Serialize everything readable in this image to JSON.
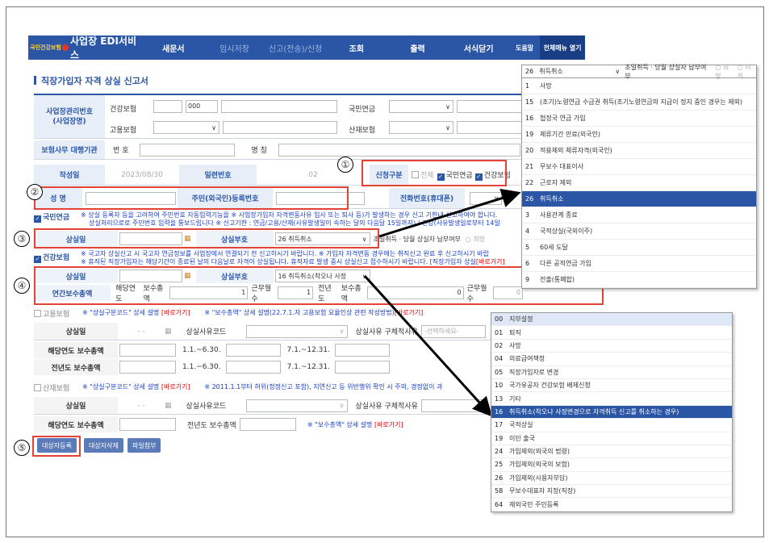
{
  "header": {
    "logo": "국민건강보험",
    "title": "사업장 EDI서비스",
    "menu": [
      "새문서",
      "임시저장",
      "신고(전송)/신청",
      "조회",
      "출력",
      "서식닫기"
    ],
    "help": "도움말",
    "all_menu": "전체메뉴 열기"
  },
  "page_title": "직장가입자 자격 상실 신고서",
  "biz": {
    "label": "사업장관리번호\n(사업장명)",
    "health": "건강보험",
    "health_val": "000",
    "pension": "국민연금",
    "employ": "고용보험",
    "injury": "산재보험",
    "agency": "보험사무 대행기관",
    "num": "번 호",
    "name": "명 칭"
  },
  "write_date_label": "작성일",
  "write_date": "2023/08/30",
  "serial_label": "일련번호",
  "serial": "02",
  "apply_label": "신청구분",
  "apply_all": "전체",
  "apply_pension": "국민연금",
  "apply_health": "건강보험",
  "name_label": "성   명",
  "rrn_label": "주민(외국인)등록번호",
  "phone_label": "전화번호(휴대폰)",
  "pension_section": "국민연금",
  "pension_note1": "※ 상실 등록자 등을 고려하여 주민번호 자동입력기능을 ※ 사업장가입자 자격변동사유 입사 또는 퇴사 등)가 발생하는 경우 신고 기한내 신고하여야 합니다.",
  "pension_note2": "상실처리으로로 주민번호 입력을 통보드립니다    ※ 신고기한 : 연금/고용/산재(사유발생일이 속하는 달의 다음달 15일까지) / 건강(사유발생일로부터 14일",
  "loss_date_label": "상실일",
  "loss_code_label": "상실부호",
  "loss_code_pension": "26   취득취소",
  "same_month": "초일취득 · 당월 상실자 납부여부",
  "hope": "희망",
  "no_hope": "미희",
  "health_section": "건강보험",
  "health_note1": "※ 국고자 상실신고 시 국고자 연금정보를 사업장에서 연결되기 전 신고하시기 바랍니다.         ※ 가입자 자격변동 경우에는 취직신고 완료 후 신고하시기 바랍",
  "health_note2": "※ 휴직된 직장가입자는 해당기간이 종료된 날의 다음날로 자격이 상실됩니다. 휴직자료 발생 중시 상실신고 접수하시기 바랍니다. [직장가입자 상실",
  "health_link": "[바로가기]",
  "loss_code_health": "16    취득취소(착오나 사정",
  "annual_label": "연간보수총액",
  "year_label": "해당연도",
  "pay_label": "보수총액",
  "pay_val": "1",
  "months_label": "근무월수",
  "months_val": "1",
  "prev_label": "전년도",
  "prev_pay_label": "보수총액",
  "prev_pay_val": "0",
  "prev_months_label": "근무월수",
  "prev_months_val": "0",
  "employ_section": "고용보험",
  "employ_note": "※ \"상실구분코드\" 상세 설명",
  "employ_link": "[바로가기]",
  "employ_note2": "※ \"보수총액\" 상세 설명(22.7.1.자 고용보험 요율인상 관련 작성방법)",
  "employ_link2": "[바로가기]",
  "e_loss_date": "상실일",
  "e_loss_dash": "-  -",
  "e_reason_code": "상실사유코드",
  "e_reason_detail": "상실사유 구체적사유",
  "e_select": "-선택하세요-",
  "e_year_pay": "해당연도 보수총액",
  "e_prev_pay": "전년도 보수총액",
  "p1": "1.1.~6.30.",
  "p2": "7.1.~12.31.",
  "injury_section": "산재보험",
  "injury_note": "※ \"상실구분코드\" 상세 설명",
  "injury_link": "[바로가기]",
  "injury_note2": "※ 2011.1.1부터 허위(정정신고 포함), 지연신고 등 위반행위 확인 시 주의, 경정없이 과",
  "i_loss_date": "상실일",
  "i_reason_code": "상실사유코드",
  "i_reason_detail": "상실사유 구체적사유",
  "i_year_pay": "해당연도 보수총액",
  "i_prev_pay": "전년도 보수총액",
  "i_pay_note": "※ \"보수총액\" 상세 설명",
  "i_pay_link": "[바로가기]",
  "buttons": {
    "register": "대상자등록",
    "delete": "대상자삭제",
    "attach": "파일첨부"
  },
  "callouts": [
    "①",
    "②",
    "③",
    "④",
    "⑤"
  ],
  "dd_top_header": {
    "code": "26",
    "value": "취득취소",
    "extra": "초일취득 · 당월 상실자 납부여부",
    "hope": "희망",
    "nohope": "미희"
  },
  "dd_top": [
    {
      "c": "1",
      "t": "사망"
    },
    {
      "c": "15",
      "t": "(조기)노령연금 수급권 취득(조기노령연금의 지급이 정지 중인 경우는 제외)"
    },
    {
      "c": "16",
      "t": "협정국 연금 가입"
    },
    {
      "c": "19",
      "t": "체류기간 만료(외국인)"
    },
    {
      "c": "20",
      "t": "적용제외 체류자격(외국인)"
    },
    {
      "c": "21",
      "t": "무보수 대표이사"
    },
    {
      "c": "22",
      "t": "근로자 제외"
    },
    {
      "c": "26",
      "t": "취득취소",
      "selected": true
    },
    {
      "c": "3",
      "t": "사용관계 종료"
    },
    {
      "c": "4",
      "t": "국적상실(국외이주)"
    },
    {
      "c": "5",
      "t": "60세 도달"
    },
    {
      "c": "6",
      "t": "다른 공적연금 가입"
    },
    {
      "c": "9",
      "t": "전출(통폐합)"
    }
  ],
  "dd_bottom": [
    {
      "c": "00",
      "t": "지부설정",
      "hl": true
    },
    {
      "c": "01",
      "t": "퇴직"
    },
    {
      "c": "02",
      "t": "사망"
    },
    {
      "c": "04",
      "t": "의료급여책정"
    },
    {
      "c": "05",
      "t": "직장가입자로 변경"
    },
    {
      "c": "10",
      "t": "국가유공자 건강보험 배제신청"
    },
    {
      "c": "13",
      "t": "기타"
    },
    {
      "c": "16",
      "t": "취득취소(착오나 사정변경으로 자격취득 신고를 취소하는 경우)",
      "selected": true
    },
    {
      "c": "17",
      "t": "국적상실"
    },
    {
      "c": "19",
      "t": "이민 출국"
    },
    {
      "c": "24",
      "t": "가입제외(외국의 법령)"
    },
    {
      "c": "25",
      "t": "가입제외(외국의 보험)"
    },
    {
      "c": "26",
      "t": "가입제외(사용자부담)"
    },
    {
      "c": "58",
      "t": "무보수대표자 지정(직장)"
    },
    {
      "c": "64",
      "t": "재외국민 주민등록"
    }
  ],
  "colors": {
    "brand": "#2b56a6",
    "highlight": "#e34234"
  }
}
